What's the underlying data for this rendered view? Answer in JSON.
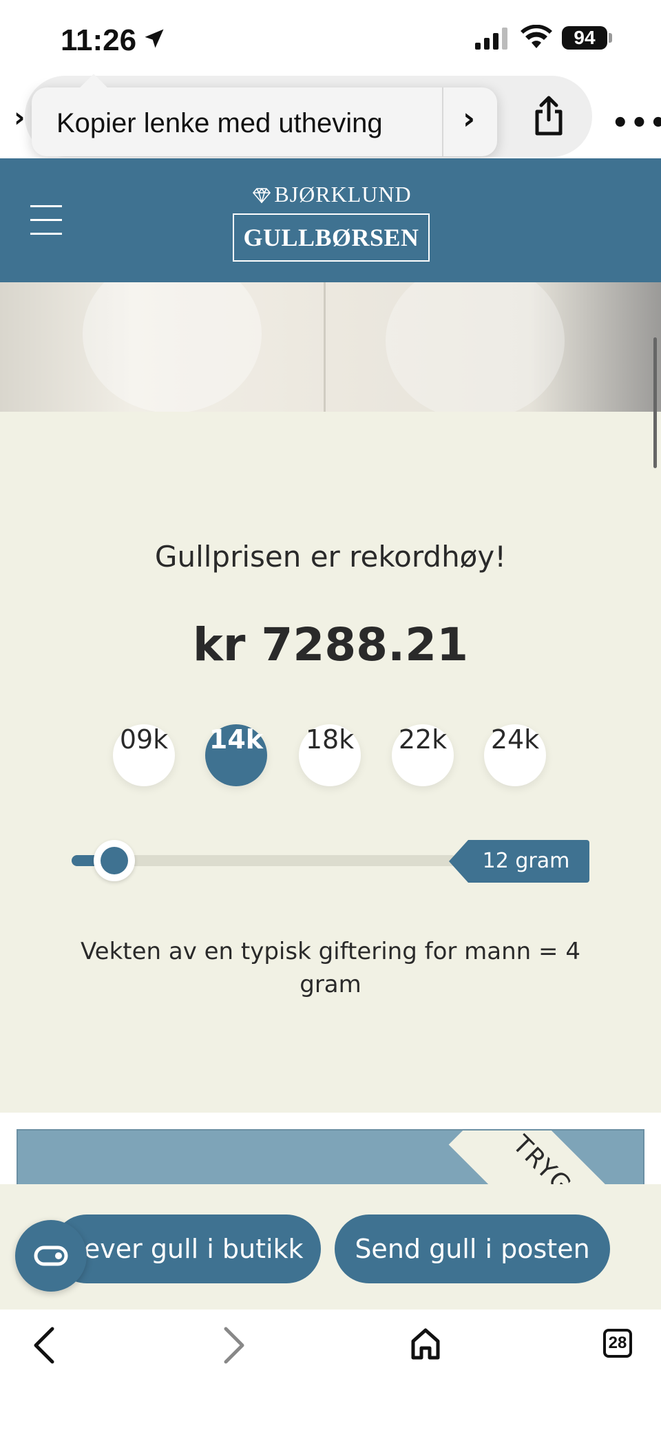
{
  "status_bar": {
    "time": "11:26",
    "battery": "94"
  },
  "browser": {
    "popup_label": "Kopier lenke med utheving",
    "tab_count": "28"
  },
  "site": {
    "brand_top": "BJØRKLUND",
    "brand_main": "GULLBØRSEN",
    "accent_color": "#3f7291",
    "panel_color": "#f1f1e4"
  },
  "calculator": {
    "headline": "Gullprisen er rekordhøy!",
    "price": "kr 7288.21",
    "karats": [
      "09k",
      "14k",
      "18k",
      "22k",
      "24k"
    ],
    "selected_karat": "14k",
    "weight_label": "12 gram",
    "weight_grams": 12,
    "caption": "Vekten av en typisk giftering for mann = 4 gram"
  },
  "banner": {
    "ribbon_text": "TRYG"
  },
  "cta": {
    "store_button": "Lever gull i butikk",
    "mail_button": "Send gull i posten"
  }
}
